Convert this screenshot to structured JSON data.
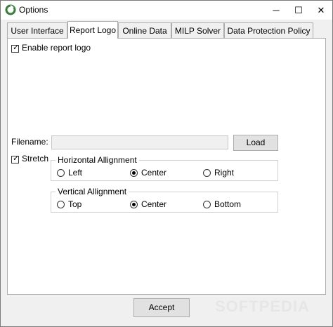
{
  "window": {
    "title": "Options",
    "minimize_glyph": "─",
    "maximize_glyph": "☐",
    "close_glyph": "✕"
  },
  "tabs": [
    {
      "label": "User Interface"
    },
    {
      "label": "Report Logo"
    },
    {
      "label": "Online Data"
    },
    {
      "label": "MILP Solver"
    },
    {
      "label": "Data Protection Policy"
    }
  ],
  "report_logo": {
    "enable_label": "Enable report logo",
    "enable_checked": true,
    "filename_label": "Filename:",
    "filename_value": "",
    "load_label": "Load",
    "stretch_label": "Stretch",
    "stretch_checked": true,
    "horizontal": {
      "title": "Horizontal Allignment",
      "options": [
        "Left",
        "Center",
        "Right"
      ],
      "selected": "Center"
    },
    "vertical": {
      "title": "Vertical Allignment",
      "options": [
        "Top",
        "Center",
        "Bottom"
      ],
      "selected": "Center"
    }
  },
  "footer": {
    "accept_label": "Accept"
  },
  "watermark": "SOFTPEDIA",
  "colors": {
    "app_icon": "#3a7d3a",
    "tab_border": "#adadad",
    "panel_bg": "#ffffff",
    "window_bg": "#f0f0f0"
  },
  "icons": {
    "app": "app-logo-icon",
    "check": "check-icon"
  }
}
